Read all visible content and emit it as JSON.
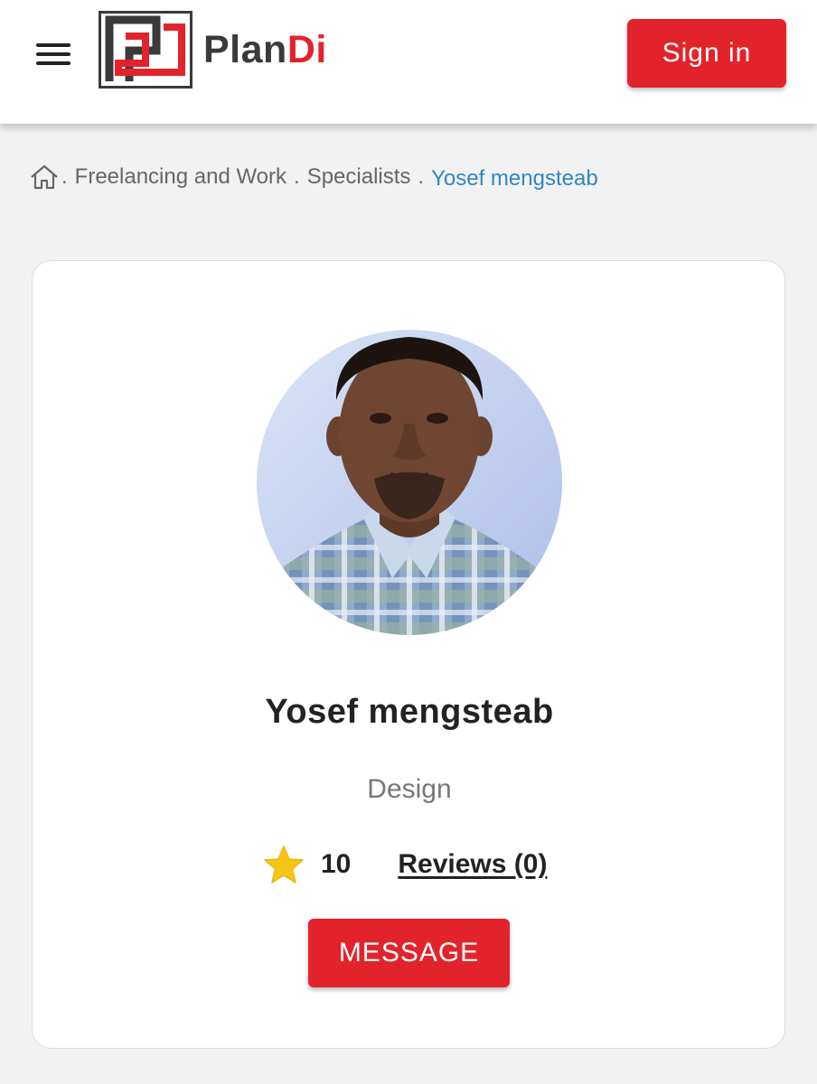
{
  "header": {
    "logo_text_main": "Plan",
    "logo_text_accent": "Di",
    "menu_icon": "hamburger-menu-icon",
    "signin_label": "Sign in"
  },
  "breadcrumb": {
    "home_icon": "home-icon",
    "separator": ".",
    "items": [
      {
        "label": "Freelancing and Work"
      },
      {
        "label": "Specialists"
      }
    ],
    "current": "Yosef mengsteab"
  },
  "profile": {
    "name": "Yosef mengsteab",
    "category": "Design",
    "rating": "10",
    "rating_icon": "star-icon",
    "reviews_label": "Reviews (0)",
    "message_label": "MESSAGE"
  },
  "colors": {
    "brand_red": "#e3232c",
    "logo_dark": "#3a3a3a",
    "link_blue": "#2f86c2",
    "star_yellow": "#f5c518",
    "page_bg": "#f2f2f2"
  }
}
